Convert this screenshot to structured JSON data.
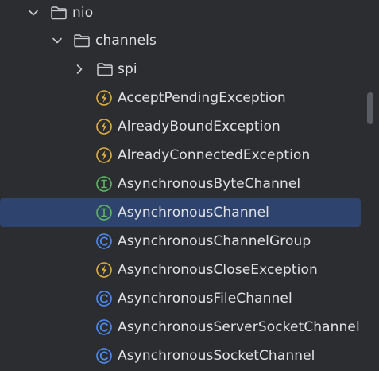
{
  "tree": {
    "items": [
      {
        "label": "nio",
        "kind": "folder",
        "expanded": true
      },
      {
        "label": "channels",
        "kind": "folder",
        "expanded": true
      },
      {
        "label": "spi",
        "kind": "folder",
        "expanded": false
      },
      {
        "label": "AcceptPendingException",
        "kind": "exception-class"
      },
      {
        "label": "AlreadyBoundException",
        "kind": "exception-class"
      },
      {
        "label": "AlreadyConnectedException",
        "kind": "exception-class"
      },
      {
        "label": "AsynchronousByteChannel",
        "kind": "interface"
      },
      {
        "label": "AsynchronousChannel",
        "kind": "interface",
        "selected": true
      },
      {
        "label": "AsynchronousChannelGroup",
        "kind": "class"
      },
      {
        "label": "AsynchronousCloseException",
        "kind": "exception-class"
      },
      {
        "label": "AsynchronousFileChannel",
        "kind": "class"
      },
      {
        "label": "AsynchronousServerSocketChannel",
        "kind": "class"
      },
      {
        "label": "AsynchronousSocketChannel",
        "kind": "class"
      }
    ]
  },
  "colors": {
    "background": "#2b2d30",
    "selection": "#2e436e",
    "text": "#dfe1e5",
    "exception_icon": "#e0b040",
    "interface_icon": "#5fb865",
    "class_icon": "#4d8df6"
  },
  "icons": {
    "folder": "folder-icon",
    "exception-class": "exception-class-icon",
    "interface": "interface-icon",
    "class": "class-icon"
  }
}
